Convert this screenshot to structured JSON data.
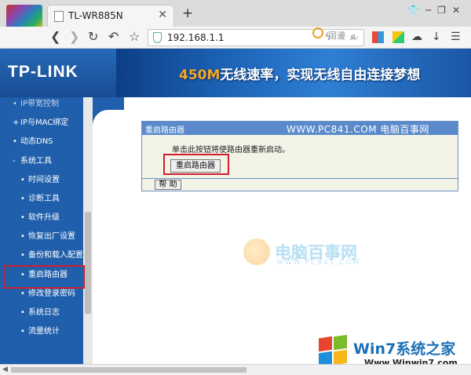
{
  "browser": {
    "tab_title": "TL-WR885N",
    "tab_close": "✕",
    "new_tab": "+",
    "url": "192.168.1.1",
    "search_hint": "国漫",
    "icons": [
      "shirt-icon",
      "minimize-icon",
      "restore-icon",
      "close-icon",
      "back-icon",
      "forward-icon",
      "reload-icon",
      "undo-icon",
      "bookmark-star-icon",
      "shield-icon",
      "lightning-icon",
      "star-icon",
      "dropdown-icon",
      "search-icon",
      "apps-icon",
      "extension-icon",
      "cloud-icon",
      "download-icon",
      "menu-icon"
    ]
  },
  "header": {
    "logo": "TP-LINK",
    "banner_speed": "450M",
    "banner_text": "无线速率，实现无线自由连接梦想"
  },
  "sidebar": {
    "items": [
      {
        "label": "IP带宽控制",
        "level": 1,
        "bullet": "•",
        "partial": true
      },
      {
        "label": "IP与MAC绑定",
        "level": 1,
        "bullet": "+"
      },
      {
        "label": "动态DNS",
        "level": 1,
        "bullet": "•"
      },
      {
        "label": "系统工具",
        "level": 1,
        "bullet": "-"
      },
      {
        "label": "时间设置",
        "level": 2,
        "bullet": "•"
      },
      {
        "label": "诊断工具",
        "level": 2,
        "bullet": "•"
      },
      {
        "label": "软件升级",
        "level": 2,
        "bullet": "•"
      },
      {
        "label": "恢复出厂设置",
        "level": 2,
        "bullet": "•"
      },
      {
        "label": "备份和载入配置",
        "level": 2,
        "bullet": "•"
      },
      {
        "label": "重启路由器",
        "level": 2,
        "bullet": "•",
        "active": true
      },
      {
        "label": "修改登录密码",
        "level": 2,
        "bullet": "•"
      },
      {
        "label": "系统日志",
        "level": 2,
        "bullet": "•"
      },
      {
        "label": "流量统计",
        "level": 2,
        "bullet": "•"
      }
    ]
  },
  "panel": {
    "title": "重启路由器",
    "watermark": "WWW.PC841.COM 电脑百事网",
    "description": "单击此按钮将使路由器重新启动。",
    "reboot_button": "重启路由器",
    "help_button": "帮 助"
  },
  "watermarks": {
    "center_name": "电脑百事网",
    "center_url": "WWW.PC841.COM",
    "br_title": "Win7系统之家",
    "br_url": "Www.Winwin7.com"
  },
  "colors": {
    "sidebar_bg": "#1f5fab",
    "highlight": "#d01f2f",
    "panel_header": "#5b8acb"
  }
}
